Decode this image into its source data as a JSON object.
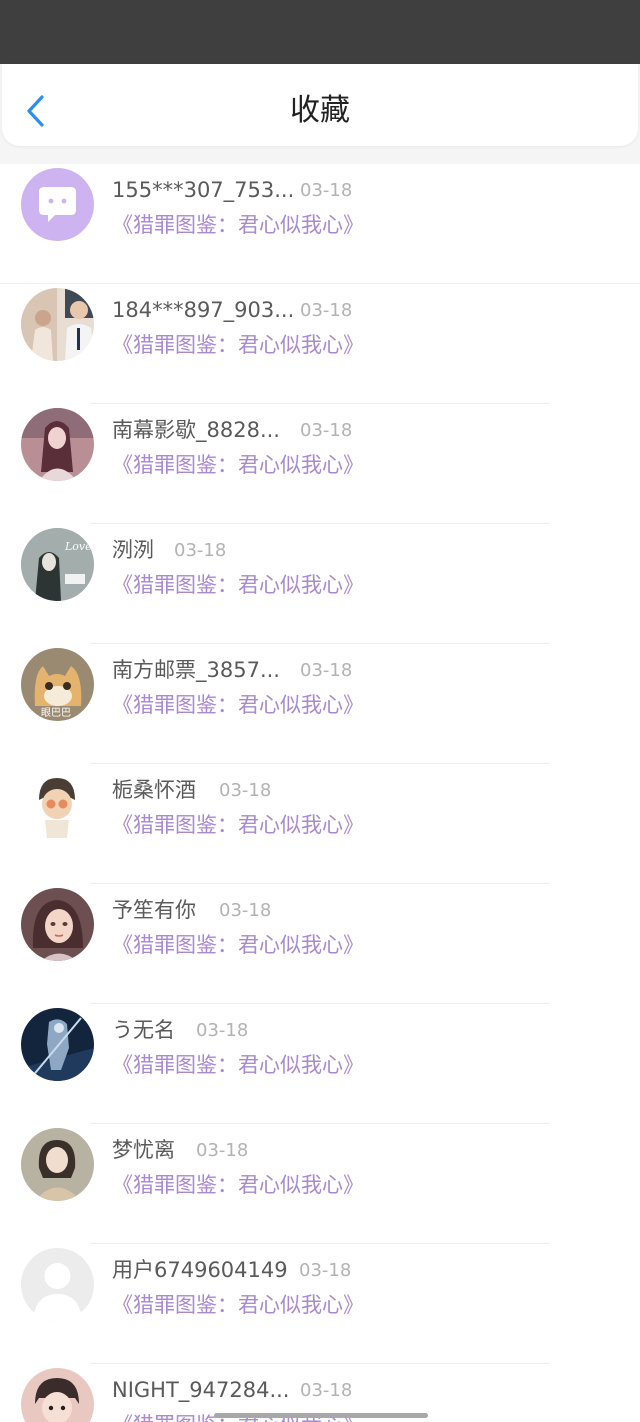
{
  "header": {
    "title": "收藏",
    "back_icon": "chevron-left-icon",
    "accent": "#2b8ff0"
  },
  "colors": {
    "name": "#5a5a5a",
    "date": "#b3b3b3",
    "work": "#a989cf",
    "status_bar": "#3f3f3f"
  },
  "favorites": [
    {
      "name": "155***307_753...",
      "date": "03-18",
      "work": "《猎罪图鉴：君心似我心》",
      "avatar": "chat-bubble-avatar",
      "avatar_color": "#cdb4f0"
    },
    {
      "name": "184***897_903...",
      "date": "03-18",
      "work": "《猎罪图鉴：君心似我心》",
      "avatar": "couple-photo-avatar",
      "avatar_color": "#d9c5b4"
    },
    {
      "name": "南幕影歇_8828...",
      "date": "03-18",
      "work": "《猎罪图鉴：君心似我心》",
      "avatar": "girl-portrait-avatar",
      "avatar_color": "#b98f95"
    },
    {
      "name": "洌洌",
      "date": "03-18",
      "work": "《猎罪图鉴：君心似我心》",
      "avatar": "love-sketch-avatar",
      "avatar_color": "#8e9a99"
    },
    {
      "name": "南方邮票_3857...",
      "date": "03-18",
      "work": "《猎罪图鉴：君心似我心》",
      "avatar": "cat-avatar",
      "avatar_label": "眼巴巴",
      "avatar_color": "#c9a26c"
    },
    {
      "name": "栀桑怀酒",
      "date": "03-18",
      "work": "《猎罪图鉴：君心似我心》",
      "avatar": "doll-avatar",
      "avatar_color": "#f3ece5"
    },
    {
      "name": "予笙有你",
      "date": "03-18",
      "work": "《猎罪图鉴：君心似我心》",
      "avatar": "anime-girl-avatar",
      "avatar_color": "#8d6b6a"
    },
    {
      "name": "う无名",
      "date": "03-18",
      "work": "《猎罪图鉴：君心似我心》",
      "avatar": "dark-warrior-avatar",
      "avatar_color": "#1f3a5c"
    },
    {
      "name": "梦忧离",
      "date": "03-18",
      "work": "《猎罪图鉴：君心似我心》",
      "avatar": "woman-photo-avatar",
      "avatar_color": "#c7b6a0"
    },
    {
      "name": "用户6749604149",
      "date": "03-18",
      "work": "《猎罪图鉴：君心似我心》",
      "avatar": "default-user-avatar",
      "avatar_color": "#ececec"
    },
    {
      "name": "NIGHT_947284...",
      "date": "03-18",
      "work": "《猎罪图鉴：君心似我心》",
      "avatar": "child-photo-avatar",
      "avatar_color": "#e8c8c0"
    }
  ]
}
